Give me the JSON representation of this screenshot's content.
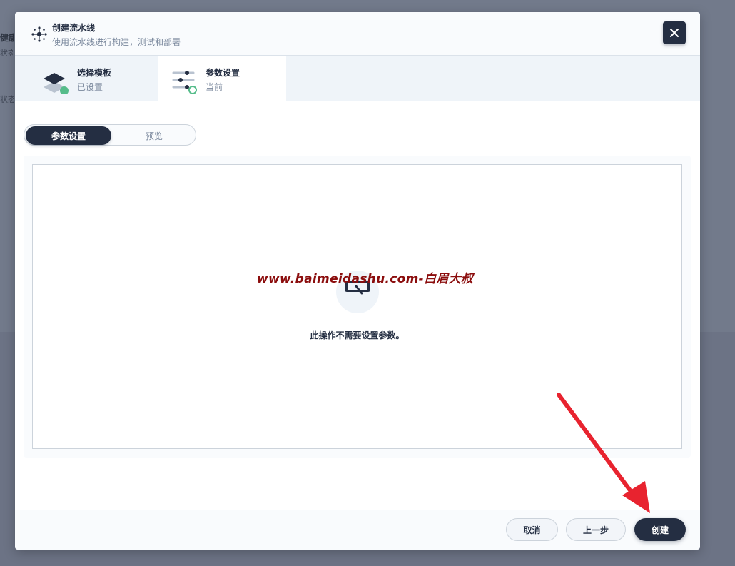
{
  "background": {
    "text1": "健康",
    "text2": "状态",
    "text3": "状态"
  },
  "modal": {
    "title": "创建流水线",
    "subtitle": "使用流水线进行构建，测试和部署"
  },
  "steps": [
    {
      "title": "选择模板",
      "status": "已设置"
    },
    {
      "title": "参数设置",
      "status": "当前"
    }
  ],
  "tabs": [
    {
      "label": "参数设置",
      "active": true
    },
    {
      "label": "预览",
      "active": false
    }
  ],
  "content": {
    "watermark": "www.baimeidashu.com-白眉大叔",
    "empty_message": "此操作不需要设置参数。"
  },
  "footer": {
    "cancel_label": "取消",
    "prev_label": "上一步",
    "create_label": "创建"
  },
  "colors": {
    "primary": "#242e42",
    "success": "#55bc8a",
    "annotation_arrow": "#e8232f",
    "watermark": "#8b0d0d"
  },
  "icons": {
    "header": "pipeline-icon",
    "close": "close-icon",
    "step1": "template-layers-icon",
    "step2": "sliders-icon",
    "empty": "no-params-icon"
  }
}
